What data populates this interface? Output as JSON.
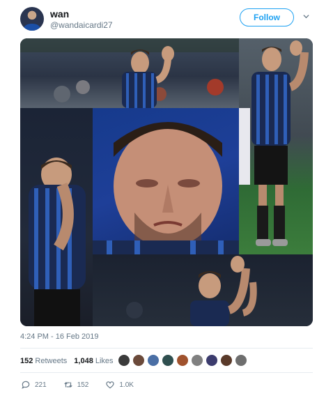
{
  "tweet": {
    "display_name": "wan",
    "handle": "@wandaicardi27",
    "follow_label": "Follow",
    "timestamp": "4:24 PM - 16 Feb 2019",
    "stats": {
      "retweets_count": "152",
      "retweets_label": "Retweets",
      "likes_count": "1,048",
      "likes_label": "Likes"
    },
    "liker_avatars": [
      "#3b3b3b",
      "#6b4a3a",
      "#4a6fa5",
      "#2f4f4f",
      "#a0522d",
      "#808080",
      "#3c3c6e",
      "#5a3a2a",
      "#6e6e6e"
    ],
    "actions": {
      "reply_count": "221",
      "retweet_count": "152",
      "like_count": "1.0K"
    }
  },
  "colors": {
    "accent": "#1da1f2",
    "secondary_text": "#657786",
    "primary_text": "#14171a"
  },
  "icons": [
    "chevron-down-icon",
    "reply-icon",
    "retweet-icon",
    "heart-icon"
  ]
}
